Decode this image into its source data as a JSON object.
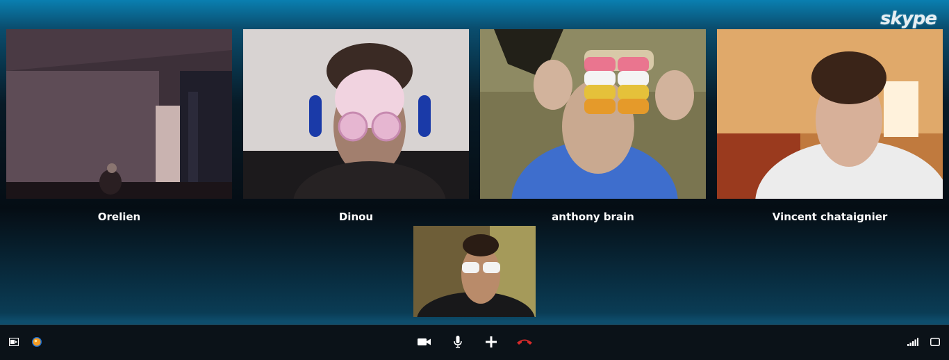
{
  "app": {
    "logo_text": "skype"
  },
  "participants": [
    {
      "name": "Orelien"
    },
    {
      "name": "Dinou"
    },
    {
      "name": "anthony brain"
    },
    {
      "name": "Vincent chataignier"
    }
  ],
  "toolbar": {
    "left_icons": [
      "exit-fullscreen-icon",
      "status-orb-icon"
    ],
    "center_icons": [
      "video-camera-icon",
      "microphone-icon",
      "add-icon",
      "hang-up-icon"
    ],
    "right_icons": [
      "signal-strength-icon",
      "window-toggle-icon"
    ],
    "hangup_color": "#d62a2a"
  }
}
